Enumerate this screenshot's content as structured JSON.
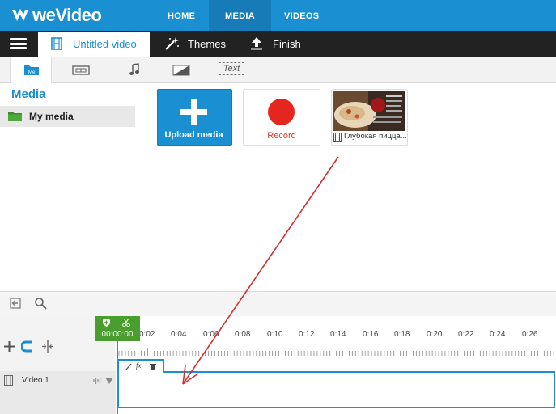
{
  "brand": {
    "name": "weVideo",
    "color": "#1a8fd1"
  },
  "topnav": {
    "items": [
      "HOME",
      "MEDIA",
      "VIDEOS"
    ],
    "active": "MEDIA"
  },
  "project_bar": {
    "menu_icon": "hamburger-icon",
    "project_title": "Untitled video",
    "themes_label": "Themes",
    "finish_label": "Finish"
  },
  "tool_tabs": {
    "text_label": "Text",
    "active": "media"
  },
  "media_panel": {
    "title": "Media",
    "folder_label": "My media",
    "upload_label": "Upload media",
    "record_label": "Record",
    "clip_label": "Глубокая пицца..."
  },
  "timeline": {
    "playhead_time": "00:00:00",
    "ticks": [
      "0:02",
      "0:04",
      "0:06",
      "0:08",
      "0:10",
      "0:12",
      "0:14",
      "0:16",
      "0:18",
      "0:20",
      "0:22",
      "0:24",
      "0:26"
    ],
    "track_label": "Video 1"
  },
  "colors": {
    "accent": "#1a8fd1",
    "record": "#e5261f",
    "playhead": "#4a9e2e",
    "annotation_arrow": "#d32f2f"
  }
}
